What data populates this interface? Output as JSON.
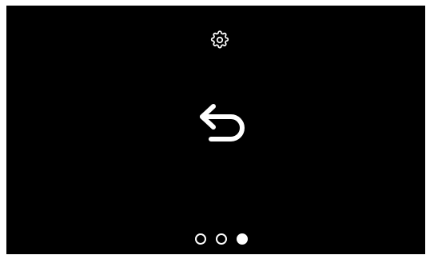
{
  "screen": {
    "background": "#000000",
    "foreground": "#ffffff"
  },
  "icons": {
    "settings": "gear-icon",
    "back": "back-arrow-icon"
  },
  "pagination": {
    "total": 3,
    "active_index": 2
  }
}
